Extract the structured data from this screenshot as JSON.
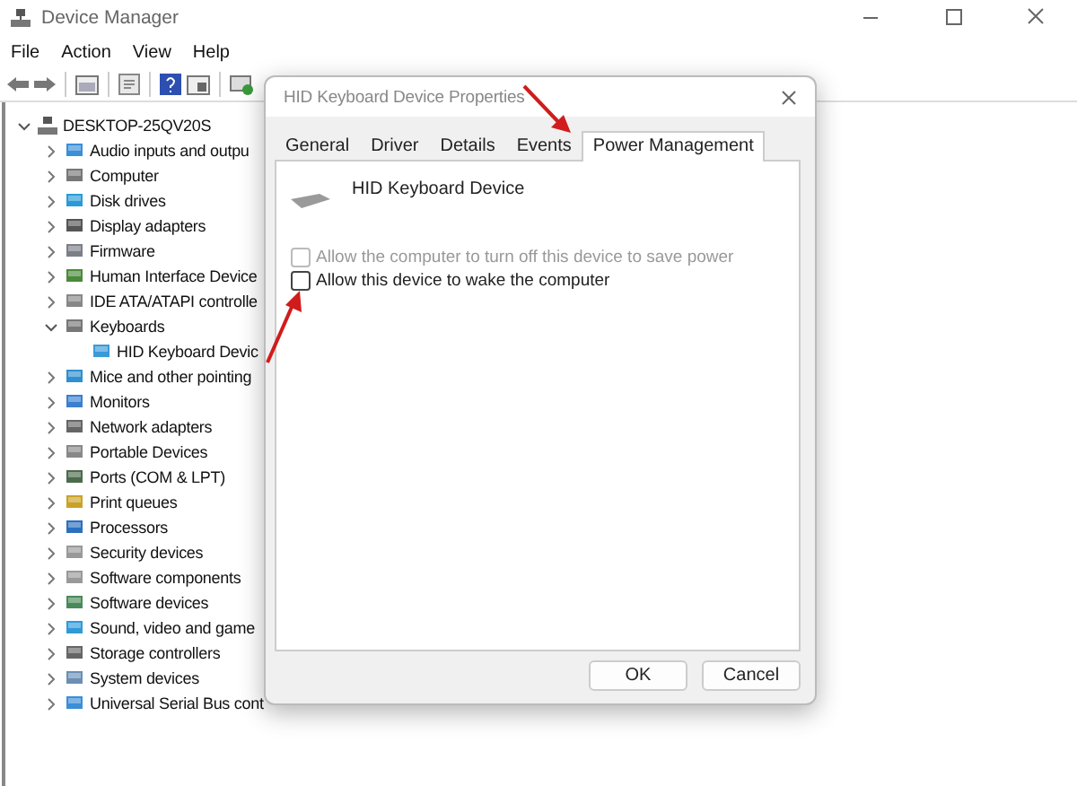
{
  "window": {
    "title": "Device Manager"
  },
  "menu": [
    "File",
    "Action",
    "View",
    "Help"
  ],
  "tree": {
    "label": "DESKTOP-25QV20S",
    "expanded": true,
    "children": [
      {
        "label": "Audio inputs and outpu",
        "expanded": false
      },
      {
        "label": "Computer",
        "expanded": false
      },
      {
        "label": "Disk drives",
        "expanded": false
      },
      {
        "label": "Display adapters",
        "expanded": false
      },
      {
        "label": "Firmware",
        "expanded": false
      },
      {
        "label": "Human Interface Device",
        "expanded": false
      },
      {
        "label": "IDE ATA/ATAPI controlle",
        "expanded": false
      },
      {
        "label": "Keyboards",
        "expanded": true,
        "children": [
          {
            "label": "HID Keyboard Devic"
          }
        ]
      },
      {
        "label": "Mice and other pointing",
        "expanded": false
      },
      {
        "label": "Monitors",
        "expanded": false
      },
      {
        "label": "Network adapters",
        "expanded": false
      },
      {
        "label": "Portable Devices",
        "expanded": false
      },
      {
        "label": "Ports (COM & LPT)",
        "expanded": false
      },
      {
        "label": "Print queues",
        "expanded": false
      },
      {
        "label": "Processors",
        "expanded": false
      },
      {
        "label": "Security devices",
        "expanded": false
      },
      {
        "label": "Software components",
        "expanded": false
      },
      {
        "label": "Software devices",
        "expanded": false
      },
      {
        "label": "Sound, video and game",
        "expanded": false
      },
      {
        "label": "Storage controllers",
        "expanded": false
      },
      {
        "label": "System devices",
        "expanded": false
      },
      {
        "label": "Universal Serial Bus cont",
        "expanded": false
      }
    ]
  },
  "dialog": {
    "title": "HID Keyboard Device Properties",
    "tabs": [
      {
        "label": "General",
        "selected": false
      },
      {
        "label": "Driver",
        "selected": false
      },
      {
        "label": "Details",
        "selected": false
      },
      {
        "label": "Events",
        "selected": false
      },
      {
        "label": "Power Management",
        "selected": true
      }
    ],
    "device_name": "HID Keyboard Device",
    "options": [
      {
        "label": "Allow the computer to turn off this device to save power",
        "checked": false,
        "disabled": true
      },
      {
        "label": "Allow this device to wake the computer",
        "checked": false,
        "disabled": false
      }
    ],
    "buttons": [
      "OK",
      "Cancel"
    ]
  }
}
